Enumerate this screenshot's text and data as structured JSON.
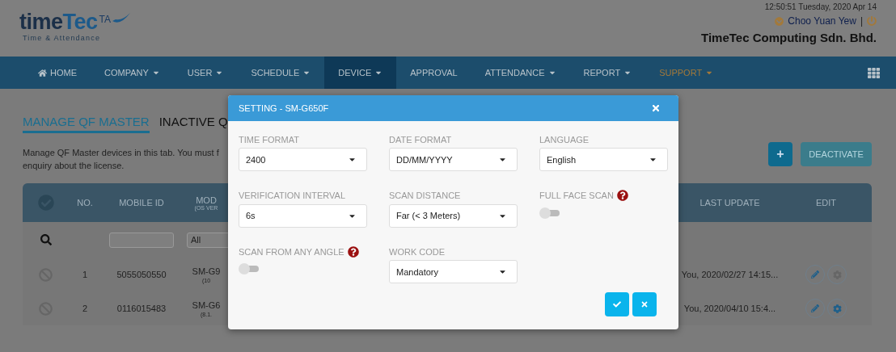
{
  "header": {
    "logo": {
      "text_1": "time",
      "text_2": "Tec",
      "badge": "TA",
      "tagline": "Time & Attendance"
    },
    "datetime": "12:50:51 Tuesday, 2020 Apr 14",
    "user": "Choo Yuan Yew",
    "separator": "|",
    "company": "TimeTec Computing Sdn. Bhd."
  },
  "nav": [
    {
      "label": "HOME",
      "kind": "home",
      "selected": false,
      "highlighted": false
    },
    {
      "label": "COMPANY",
      "kind": "menu",
      "selected": false,
      "highlighted": false
    },
    {
      "label": "USER",
      "kind": "menu",
      "selected": false,
      "highlighted": false
    },
    {
      "label": "SCHEDULE",
      "kind": "menu",
      "selected": false,
      "highlighted": false
    },
    {
      "label": "DEVICE",
      "kind": "menu",
      "selected": true,
      "highlighted": false
    },
    {
      "label": "APPROVAL",
      "kind": "link",
      "selected": false,
      "highlighted": false
    },
    {
      "label": "ATTENDANCE",
      "kind": "menu",
      "selected": false,
      "highlighted": false
    },
    {
      "label": "REPORT",
      "kind": "menu",
      "selected": false,
      "highlighted": false
    },
    {
      "label": "SUPPORT",
      "kind": "menu",
      "selected": false,
      "highlighted": true
    }
  ],
  "tabs": [
    {
      "label": "MANAGE QF MASTER",
      "selected": true
    },
    {
      "label": "INACTIVE Q",
      "selected": false
    }
  ],
  "description": [
    "Manage QF Master devices in this tab. You must f",
    "enquiry about the license."
  ],
  "actions": {
    "add": "+",
    "deactivate": {
      "label": "DEACTIVATE",
      "disabled": true
    }
  },
  "table": {
    "select_all": {
      "checked": false
    },
    "columns": [
      {
        "label": "NO."
      },
      {
        "label": "MOBILE ID"
      },
      {
        "label": "MOD",
        "sub": "(OS VER"
      },
      {
        "label": "LAST UPDATE"
      },
      {
        "label": "EDIT"
      }
    ],
    "filter": {
      "model": "All"
    },
    "rows": [
      {
        "no": "1",
        "mobile_id": "5055050550",
        "model": "SM-G9",
        "os": "(10",
        "last_update": "You, 2020/02/27 14:15...",
        "settings_enabled": false
      },
      {
        "no": "2",
        "mobile_id": "0116015483",
        "model": "SM-G6",
        "os": "(8.1.",
        "last_update": "You, 2020/04/10 15:4...",
        "settings_enabled": true
      }
    ]
  },
  "modal": {
    "title": "SETTING - SM-G650F",
    "fields": [
      {
        "kind": "select",
        "label": "TIME FORMAT",
        "value": "2400"
      },
      {
        "kind": "select",
        "label": "DATE FORMAT",
        "value": "DD/MM/YYYY"
      },
      {
        "kind": "select",
        "label": "LANGUAGE",
        "value": "English"
      },
      {
        "kind": "select",
        "label": "VERIFICATION INTERVAL",
        "value": "6s"
      },
      {
        "kind": "select",
        "label": "SCAN DISTANCE",
        "value": "Far (< 3 Meters)"
      },
      {
        "kind": "toggle",
        "label": "FULL FACE SCAN",
        "on": false
      },
      {
        "kind": "toggle",
        "label": "SCAN FROM ANY ANGLE",
        "on": false
      },
      {
        "kind": "select",
        "label": "WORK CODE",
        "value": "Mandatory"
      }
    ]
  }
}
